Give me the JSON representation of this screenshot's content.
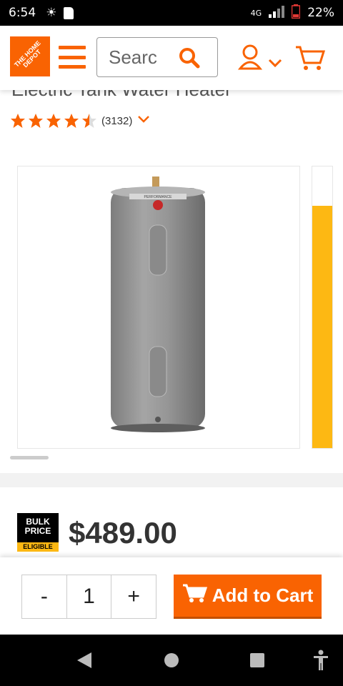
{
  "status_bar": {
    "time": "6:54",
    "network": "4G",
    "battery": "22%"
  },
  "header": {
    "logo_text": "THE HOME DEPOT",
    "search_placeholder": "Searc"
  },
  "product": {
    "title": "Electric Tank Water Heater",
    "rating_count": "(3132)",
    "rating_value": 4.5,
    "image_alt": "Rheem Performance water heater",
    "image_brand": "PERFORMANCE"
  },
  "pricing": {
    "bulk_line1": "BULK",
    "bulk_line2": "PRICE",
    "bulk_eligible": "ELIGIBLE",
    "price": "$489.00"
  },
  "cart_bar": {
    "minus_label": "-",
    "quantity": "1",
    "plus_label": "+",
    "add_to_cart_label": "Add to Cart"
  },
  "colors": {
    "brand": "#f96302",
    "yellow": "#fdb813"
  },
  "icons": [
    "sun-icon",
    "sd-card-icon",
    "signal-icon",
    "battery-icon",
    "menu-icon",
    "search-icon",
    "account-icon",
    "chevron-down-icon",
    "cart-icon",
    "star-icon",
    "back-icon",
    "home-icon",
    "recents-icon",
    "accessibility-icon"
  ]
}
